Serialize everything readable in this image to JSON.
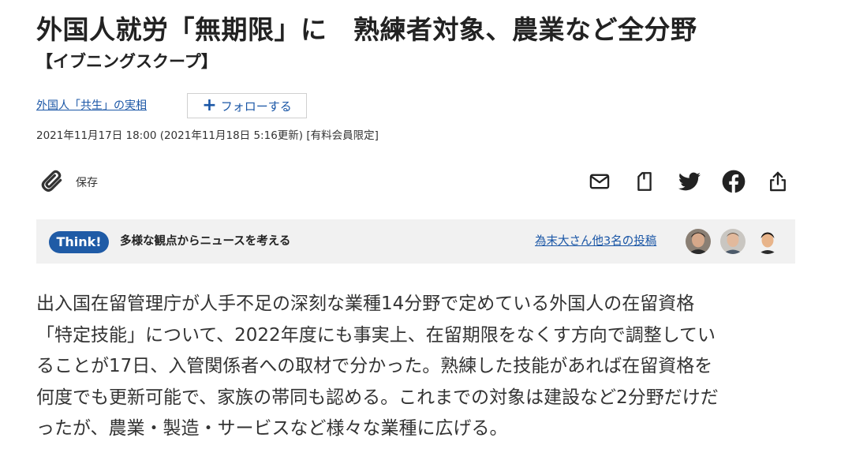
{
  "article": {
    "headline": "外国人就労「無期限」に　熟練者対象、農業など全分野",
    "kicker": "【イブニングスクープ】",
    "topic_link": "外国人「共生」の実相",
    "follow_label": "フォローする",
    "dateline": "2021年11月17日 18:00 (2021年11月18日 5:16更新) [有料会員限定]",
    "body_lines": [
      "出入国在留管理庁が人手不足の深刻な業種14分野で定めている外国人の在留資格",
      "「特定技能」について、2022年度にも事実上、在留期限をなくす方向で調整してい",
      "ることが17日、入管関係者への取材で分かった。熟練した技能があれば在留資格を",
      "何度でも更新可能で、家族の帯同も認める。これまでの対象は建設など2分野だけだ",
      "ったが、農業・製造・サービスなど様々な業種に広げる。"
    ]
  },
  "toolbar": {
    "save_label": "保存",
    "share_icons": [
      "mail-icon",
      "bookmark-icon",
      "twitter-icon",
      "facebook-icon",
      "share-icon"
    ]
  },
  "think": {
    "badge": "Think!",
    "text": "多様な観点からニュースを考える",
    "posts_link": "為末大さん他3名の投稿"
  },
  "colors": {
    "link": "#1a56a6",
    "think_badge": "#1f5ba6",
    "think_background": "#f1f1f1",
    "text": "#222222"
  }
}
